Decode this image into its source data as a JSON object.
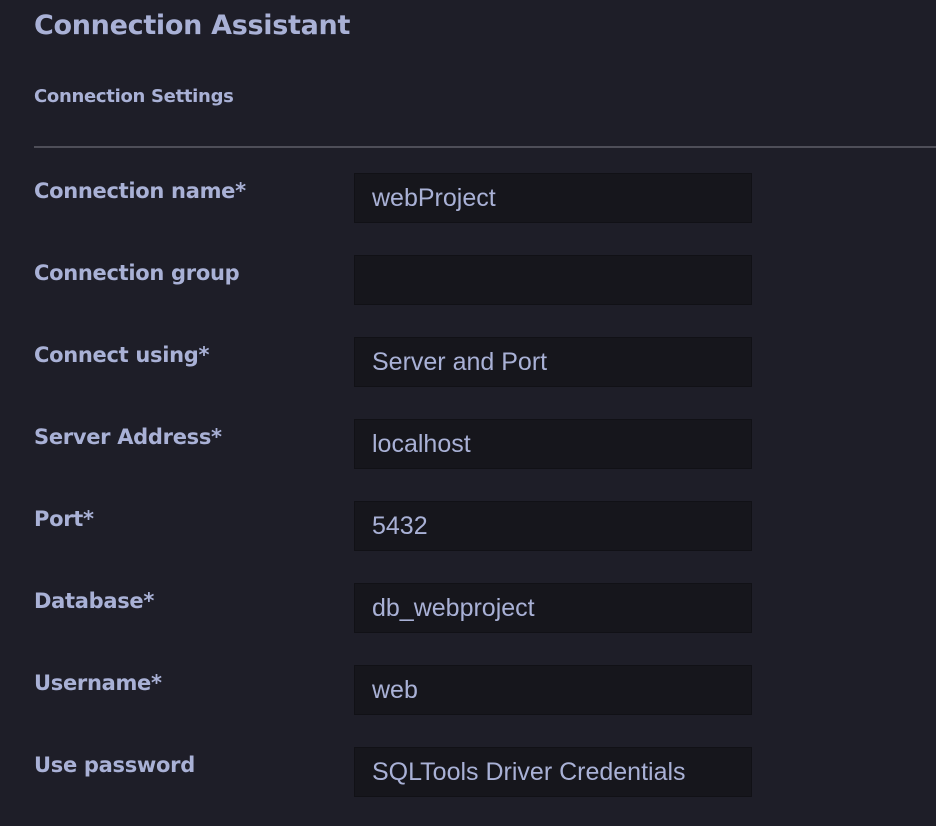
{
  "header": {
    "title": "Connection Assistant",
    "section": "Connection Settings"
  },
  "fields": [
    {
      "label": "Connection name*",
      "value": "webProject"
    },
    {
      "label": "Connection group",
      "value": ""
    },
    {
      "label": "Connect using*",
      "value": "Server and Port"
    },
    {
      "label": "Server Address*",
      "value": "localhost"
    },
    {
      "label": "Port*",
      "value": "5432"
    },
    {
      "label": "Database*",
      "value": "db_webproject"
    },
    {
      "label": "Username*",
      "value": "web"
    },
    {
      "label": "Use password",
      "value": "SQLTools Driver Credentials"
    }
  ]
}
